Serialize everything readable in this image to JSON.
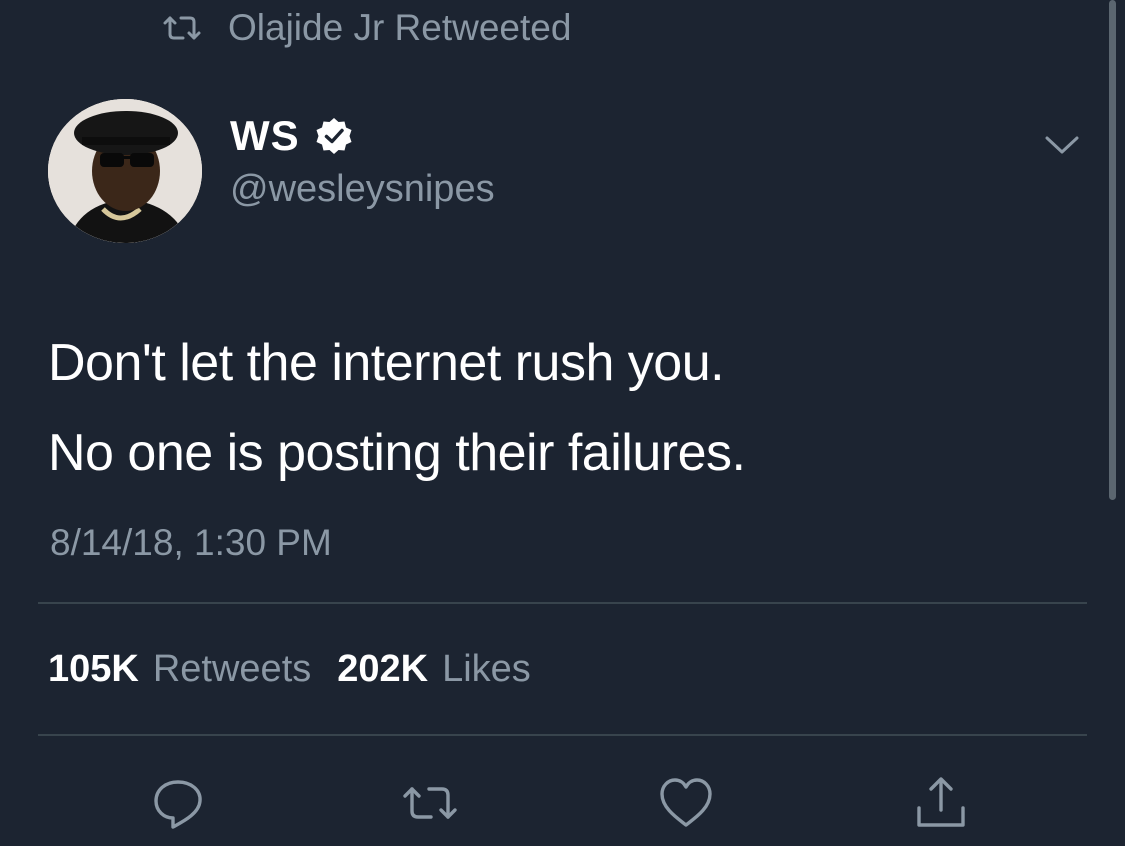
{
  "retweet_context": {
    "icon": "retweet-icon",
    "text": "Olajide Jr Retweeted"
  },
  "author": {
    "display_name": "WS",
    "handle": "@wesleysnipes",
    "verified": true,
    "verified_icon": "verified-badge-icon"
  },
  "menu": {
    "icon": "chevron-down-icon"
  },
  "tweet": {
    "lines": [
      "Don't let the internet rush you.",
      "No one is posting their failures."
    ],
    "timestamp": "8/14/18, 1:30 PM"
  },
  "stats": {
    "retweets_count": "105K",
    "retweets_label": "Retweets",
    "likes_count": "202K",
    "likes_label": "Likes"
  },
  "actions": [
    {
      "icon": "reply-icon"
    },
    {
      "icon": "retweet-icon"
    },
    {
      "icon": "like-heart-icon"
    },
    {
      "icon": "share-icon"
    }
  ],
  "colors": {
    "background": "#1c2431",
    "text_primary": "#ffffff",
    "text_secondary": "#8b98a5",
    "divider": "#38444d"
  }
}
